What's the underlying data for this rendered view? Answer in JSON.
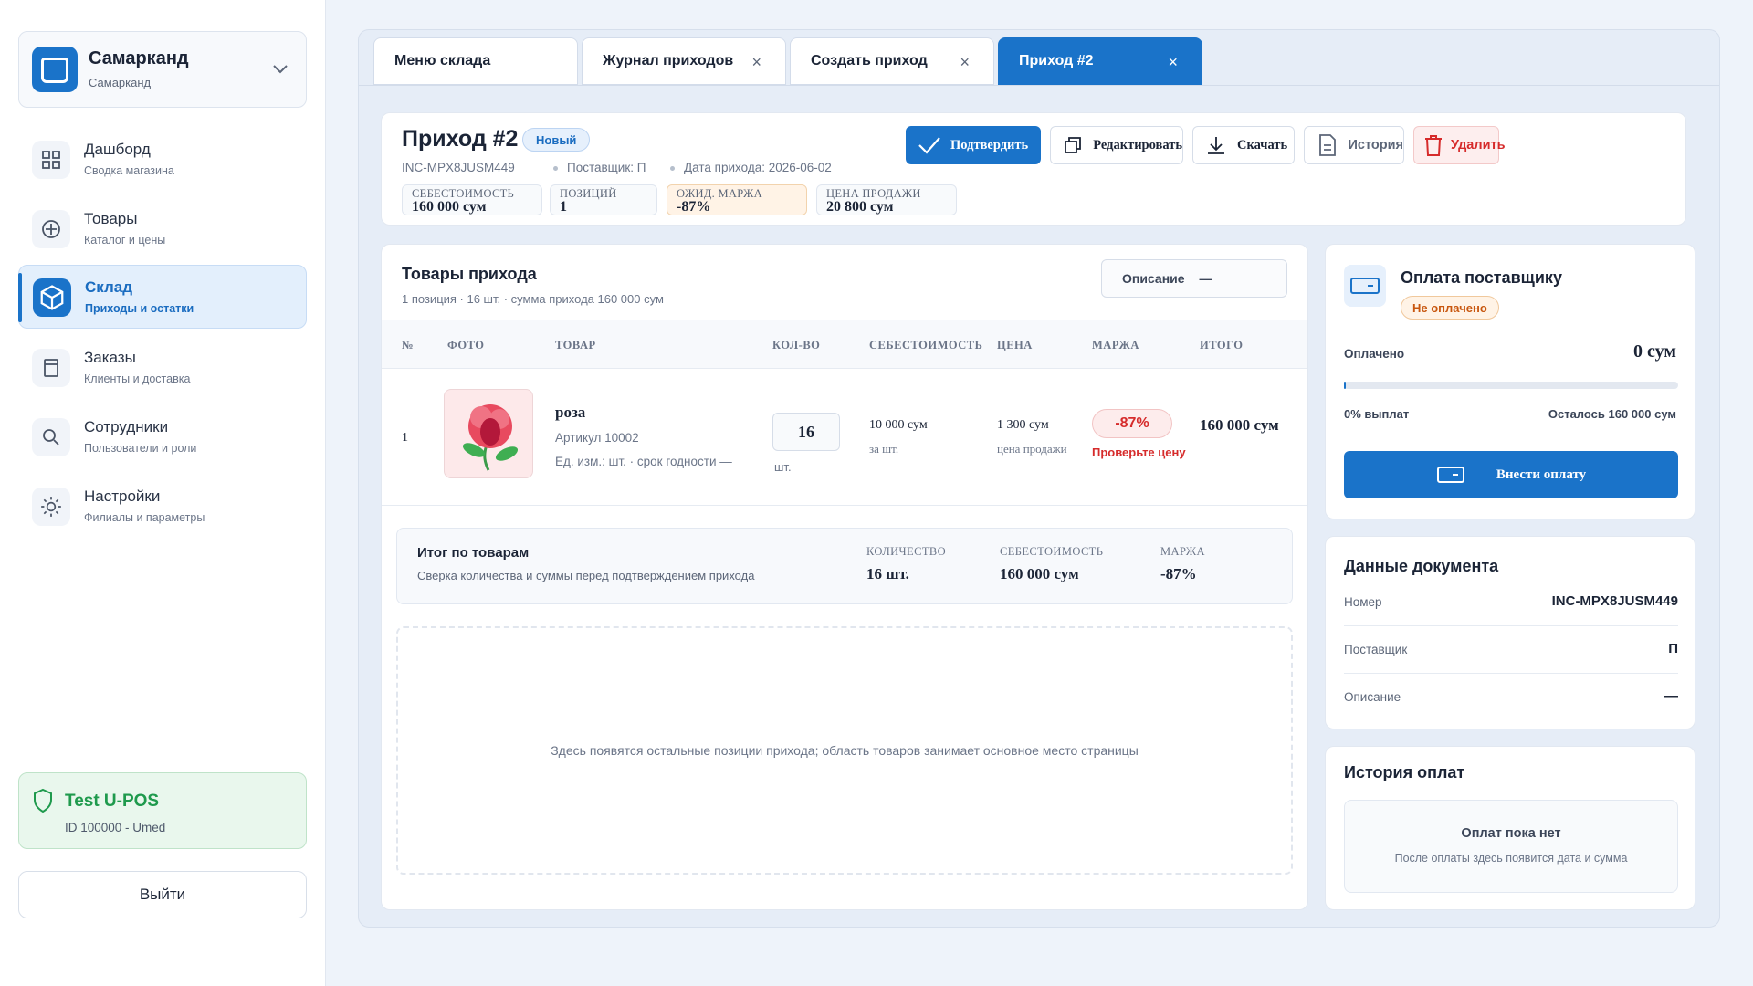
{
  "store": {
    "title": "Самарканд",
    "subtitle": "Самарканд"
  },
  "nav": [
    {
      "title": "Дашборд",
      "sub": "Сводка магазина",
      "icon": "grid-icon"
    },
    {
      "title": "Товары",
      "sub": "Каталог и цены",
      "icon": "tag-icon"
    },
    {
      "title": "Склад",
      "sub": "Приходы и остатки",
      "icon": "box-icon"
    },
    {
      "title": "Заказы",
      "sub": "Клиенты и доставка",
      "icon": "orders-icon"
    },
    {
      "title": "Сотрудники",
      "sub": "Пользователи и роли",
      "icon": "user-icon"
    },
    {
      "title": "Настройки",
      "sub": "Филиалы и параметры",
      "icon": "gear-icon"
    }
  ],
  "company": {
    "name": "Test U-POS",
    "id": "ID 100000 - Umed"
  },
  "logout": "Выйти",
  "tabs": [
    {
      "label": "Меню склада"
    },
    {
      "label": "Журнал приходов",
      "close": "×"
    },
    {
      "label": "Создать приход",
      "close": "×"
    },
    {
      "label": "Приход #2",
      "close": "×"
    }
  ],
  "header": {
    "title": "Приход #2",
    "status": "Новый",
    "code": "INC-MPX8JUSM449",
    "supplier": "Поставщик: П",
    "date": "Дата прихода: 2026-06-02",
    "stats": [
      {
        "label": "СЕБЕСТОИМОСТЬ",
        "value": "160 000 сум"
      },
      {
        "label": "ПОЗИЦИЙ",
        "value": "1"
      },
      {
        "label": "ОЖИД. МАРЖА",
        "value": "-87%"
      },
      {
        "label": "ЦЕНА ПРОДАЖИ",
        "value": "20 800 сум"
      }
    ],
    "buttons": {
      "confirm": "Подтвердить",
      "edit": "Редактировать",
      "download": "Скачать",
      "history": "История",
      "delete": "Удалить"
    }
  },
  "products": {
    "title": "Товары прихода",
    "subtitle": "1 позиция · 16 шт. · сумма прихода 160 000 сум",
    "description_label": "Описание",
    "description_value": "—",
    "columns": [
      "№",
      "ФОТО",
      "ТОВАР",
      "КОЛ-ВО",
      "СЕБЕСТОИМОСТЬ",
      "ЦЕНА",
      "МАРЖА",
      "ИТОГО"
    ],
    "row": {
      "num": "1",
      "name": "роза",
      "article": "Артикул 10002",
      "unit": "Ед. изм.: шт. · срок годности —",
      "qty": "16",
      "qty_unit": "шт.",
      "cost": "10 000 сум",
      "cost_sub": "за шт.",
      "price": "1 300 сум",
      "price_sub": "цена продажи",
      "margin": "-87%",
      "margin_warn": "Проверьте цену",
      "total": "160 000 сум"
    },
    "summary": {
      "title": "Итог по товарам",
      "subtitle": "Сверка количества и суммы перед подтверждением прихода",
      "qty_label": "КОЛИЧЕСТВО",
      "qty_value": "16 шт.",
      "cost_label": "СЕБЕСТОИМОСТЬ",
      "cost_value": "160 000 сум",
      "margin_label": "МАРЖА",
      "margin_value": "-87%"
    },
    "empty_text": "Здесь появятся остальные позиции прихода; область товаров занимает основное место страницы"
  },
  "payment": {
    "title": "Оплата поставщику",
    "status": "Не оплачено",
    "paid_label": "Оплачено",
    "paid_value": "0 сум",
    "progress_fraction": 0.0,
    "percent_text": "0% выплат",
    "remaining_text": "Осталось 160 000 сум",
    "button": "Внести оплату"
  },
  "document": {
    "title": "Данные документа",
    "rows": [
      {
        "k": "Номер",
        "v": "INC-MPX8JUSM449"
      },
      {
        "k": "Поставщик",
        "v": "П"
      },
      {
        "k": "Описание",
        "v": "—"
      }
    ]
  },
  "history": {
    "title": "История оплат",
    "empty_title": "Оплат пока нет",
    "empty_sub": "После оплаты здесь появится дата и сумма"
  },
  "colors": {
    "accent": "#1a73c9",
    "danger": "#d62b2b",
    "success": "#1f9a4d",
    "warning": "#c8570f"
  }
}
